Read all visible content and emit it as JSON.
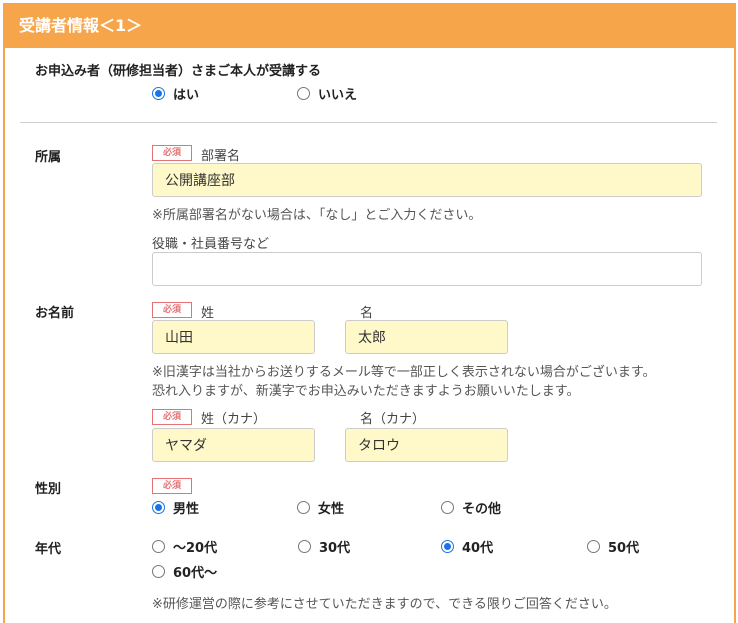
{
  "header": {
    "title": "受講者情報＜1＞"
  },
  "applicant_question": {
    "label": "お申込み者（研修担当者）さまご本人が受講する",
    "options": [
      {
        "label": "はい",
        "selected": true
      },
      {
        "label": "いいえ",
        "selected": false
      }
    ]
  },
  "affiliation": {
    "section_label": "所属",
    "required_badge": "必須",
    "dept_label": "部署名",
    "dept_value": "公開講座部",
    "dept_note": "※所属部署名がない場合は、「なし」とご入力ください。",
    "position_label": "役職・社員番号など",
    "position_value": ""
  },
  "name": {
    "section_label": "お名前",
    "required_badge": "必須",
    "last_label": "姓",
    "first_label": "名",
    "last_value": "山田",
    "first_value": "太郎",
    "note_line1": "※旧漢字は当社からお送りするメール等で一部正しく表示されない場合がございます。",
    "note_line2": "恐れ入りますが、新漢字でお申込みいただきますようお願いいたします。",
    "kana_badge": "必須",
    "last_kana_label": "姓（カナ）",
    "first_kana_label": "名（カナ）",
    "last_kana_value": "ヤマダ",
    "first_kana_value": "タロウ"
  },
  "gender": {
    "section_label": "性別",
    "required_badge": "必須",
    "options": [
      {
        "label": "男性",
        "selected": true
      },
      {
        "label": "女性",
        "selected": false
      },
      {
        "label": "その他",
        "selected": false
      }
    ]
  },
  "age": {
    "section_label": "年代",
    "options": [
      {
        "label": "～20代",
        "selected": false
      },
      {
        "label": "30代",
        "selected": false
      },
      {
        "label": "40代",
        "selected": true
      },
      {
        "label": "50代",
        "selected": false
      },
      {
        "label": "60代～",
        "selected": false
      }
    ],
    "note": "※研修運営の際に参考にさせていただきますので、できる限りご回答ください。"
  },
  "colors": {
    "accent": "#f7a54a",
    "required": "#e57373",
    "input_fill": "#fff9c9",
    "radio": "#1a73e8"
  }
}
